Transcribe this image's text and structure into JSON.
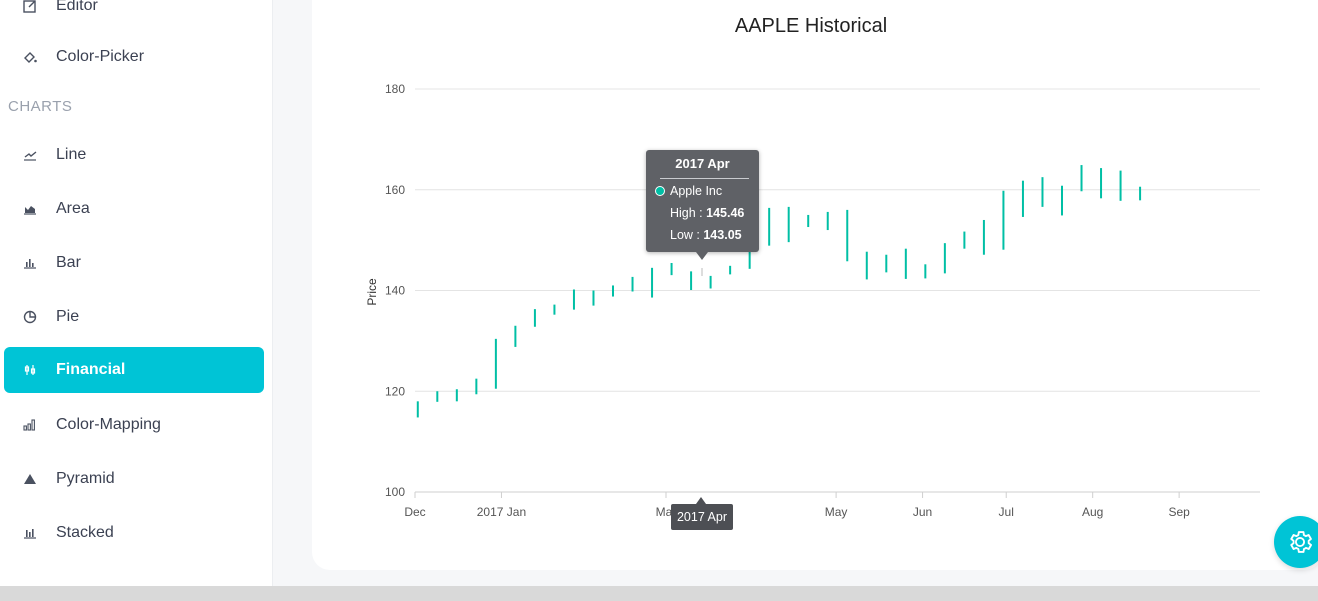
{
  "sidebar": {
    "section_label": "CHARTS",
    "items": [
      {
        "label": "Editor",
        "icon": "edit-icon"
      },
      {
        "label": "Color-Picker",
        "icon": "paint-bucket-icon"
      },
      {
        "label": "Line",
        "icon": "line-chart-icon"
      },
      {
        "label": "Area",
        "icon": "area-chart-icon"
      },
      {
        "label": "Bar",
        "icon": "bar-chart-icon"
      },
      {
        "label": "Pie",
        "icon": "pie-chart-icon"
      },
      {
        "label": "Financial",
        "icon": "candlestick-icon",
        "active": true
      },
      {
        "label": "Color-Mapping",
        "icon": "color-mapping-icon"
      },
      {
        "label": "Pyramid",
        "icon": "pyramid-icon"
      },
      {
        "label": "Stacked",
        "icon": "stacked-chart-icon"
      }
    ]
  },
  "colors": {
    "accent": "#00c4d6",
    "series": "#00bfa5"
  },
  "tooltip": {
    "title": "2017 Apr",
    "series_name": "Apple Inc",
    "high_label": "High : ",
    "high_value": "145.46",
    "low_label": "Low : ",
    "low_value": "143.05"
  },
  "crosshair": {
    "x_label": "2017 Apr"
  },
  "chart_data": {
    "type": "hilo",
    "title": "AAPLE Historical",
    "ylabel": "Price",
    "xlabel": "",
    "ylim": [
      100,
      180
    ],
    "yticks": [
      100,
      120,
      140,
      160,
      180
    ],
    "x_range": [
      "2016-12-01",
      "2017-09-30"
    ],
    "xticks": [
      {
        "label": "Dec",
        "date": "2016-12-01"
      },
      {
        "label": "2017 Jan",
        "date": "2017-01-01"
      },
      {
        "label": "Mar",
        "date": "2017-03-01"
      },
      {
        "label": "May",
        "date": "2017-05-01"
      },
      {
        "label": "Jun",
        "date": "2017-06-01"
      },
      {
        "label": "Jul",
        "date": "2017-07-01"
      },
      {
        "label": "Aug",
        "date": "2017-08-01"
      },
      {
        "label": "Sep",
        "date": "2017-09-01"
      }
    ],
    "grid": true,
    "series": [
      {
        "name": "Apple Inc",
        "points": [
          {
            "date": "2016-12-02",
            "low": 114.8,
            "high": 118.0
          },
          {
            "date": "2016-12-09",
            "low": 117.9,
            "high": 120.0
          },
          {
            "date": "2016-12-16",
            "low": 118.0,
            "high": 120.4
          },
          {
            "date": "2016-12-23",
            "low": 119.4,
            "high": 122.5
          },
          {
            "date": "2016-12-30",
            "low": 120.5,
            "high": 130.4
          },
          {
            "date": "2017-01-06",
            "low": 128.8,
            "high": 133.0
          },
          {
            "date": "2017-01-13",
            "low": 132.8,
            "high": 136.3
          },
          {
            "date": "2017-01-20",
            "low": 135.2,
            "high": 137.2
          },
          {
            "date": "2017-01-27",
            "low": 136.2,
            "high": 140.2
          },
          {
            "date": "2017-02-03",
            "low": 137.0,
            "high": 140.0
          },
          {
            "date": "2017-02-10",
            "low": 138.8,
            "high": 141.0
          },
          {
            "date": "2017-02-17",
            "low": 139.8,
            "high": 142.7
          },
          {
            "date": "2017-02-24",
            "low": 138.6,
            "high": 144.5
          },
          {
            "date": "2017-03-03",
            "low": 143.05,
            "high": 145.46
          },
          {
            "date": "2017-03-10",
            "low": 140.1,
            "high": 143.8
          },
          {
            "date": "2017-03-17",
            "low": 140.4,
            "high": 142.9
          },
          {
            "date": "2017-03-24",
            "low": 143.2,
            "high": 144.9
          },
          {
            "date": "2017-03-31",
            "low": 144.3,
            "high": 148.9
          },
          {
            "date": "2017-04-07",
            "low": 148.9,
            "high": 156.4
          },
          {
            "date": "2017-04-14",
            "low": 149.6,
            "high": 156.6
          },
          {
            "date": "2017-04-21",
            "low": 152.6,
            "high": 155.0
          },
          {
            "date": "2017-04-28",
            "low": 152.0,
            "high": 155.6
          },
          {
            "date": "2017-05-05",
            "low": 145.8,
            "high": 156.0
          },
          {
            "date": "2017-05-12",
            "low": 142.2,
            "high": 147.7
          },
          {
            "date": "2017-05-19",
            "low": 143.6,
            "high": 147.1
          },
          {
            "date": "2017-05-26",
            "low": 142.3,
            "high": 148.3
          },
          {
            "date": "2017-06-02",
            "low": 142.4,
            "high": 145.2
          },
          {
            "date": "2017-06-09",
            "low": 143.4,
            "high": 149.4
          },
          {
            "date": "2017-06-16",
            "low": 148.3,
            "high": 151.7
          },
          {
            "date": "2017-06-23",
            "low": 147.1,
            "high": 154.0
          },
          {
            "date": "2017-06-30",
            "low": 148.1,
            "high": 159.8
          },
          {
            "date": "2017-07-07",
            "low": 154.6,
            "high": 161.8
          },
          {
            "date": "2017-07-14",
            "low": 156.6,
            "high": 162.5
          },
          {
            "date": "2017-07-21",
            "low": 154.9,
            "high": 160.8
          },
          {
            "date": "2017-07-28",
            "low": 159.7,
            "high": 164.9
          },
          {
            "date": "2017-08-04",
            "low": 158.3,
            "high": 164.3
          },
          {
            "date": "2017-08-11",
            "low": 157.8,
            "high": 163.8
          },
          {
            "date": "2017-08-18",
            "low": 157.9,
            "high": 160.6
          }
        ]
      }
    ]
  }
}
